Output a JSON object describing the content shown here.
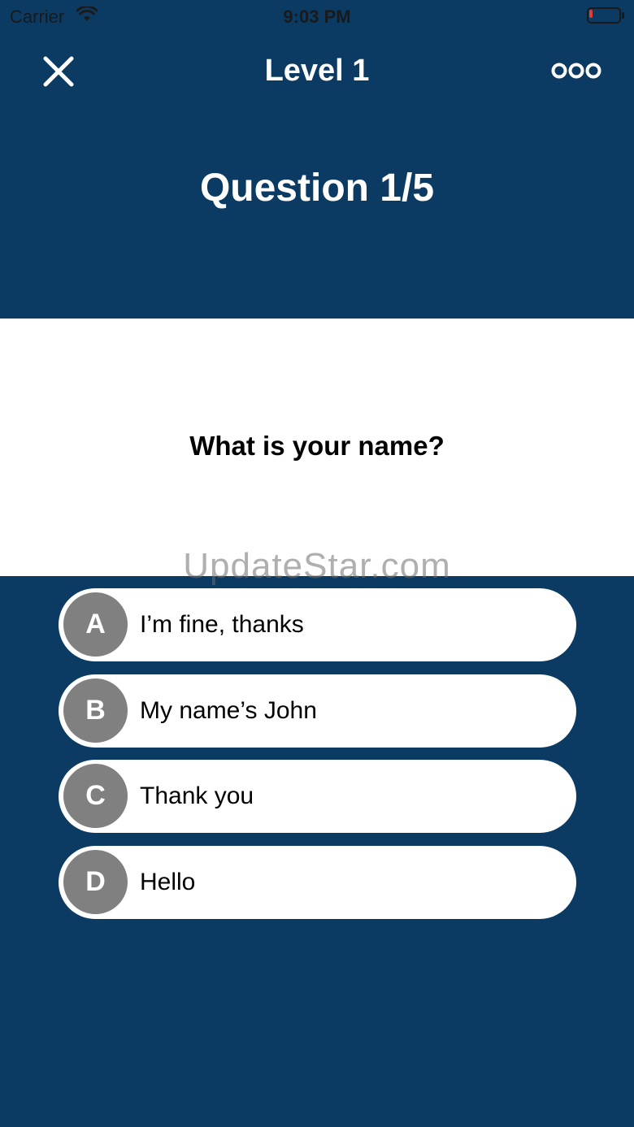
{
  "status_bar": {
    "carrier": "Carrier",
    "time": "9:03 PM",
    "battery_level": 0.12,
    "battery_color": "#e53935"
  },
  "nav": {
    "title": "Level 1",
    "close_icon": "close-icon",
    "more_icon": "more-icon"
  },
  "quiz": {
    "counter": "Question 1/5",
    "question": "What is your name?",
    "answers": [
      {
        "letter": "A",
        "text": "I’m fine, thanks"
      },
      {
        "letter": "B",
        "text": "My name’s John"
      },
      {
        "letter": "C",
        "text": "Thank you"
      },
      {
        "letter": "D",
        "text": "Hello"
      }
    ]
  },
  "watermark": "UpdateStar.com",
  "colors": {
    "background": "#0b3a63",
    "panel": "#ffffff",
    "letter_badge": "#808080"
  }
}
